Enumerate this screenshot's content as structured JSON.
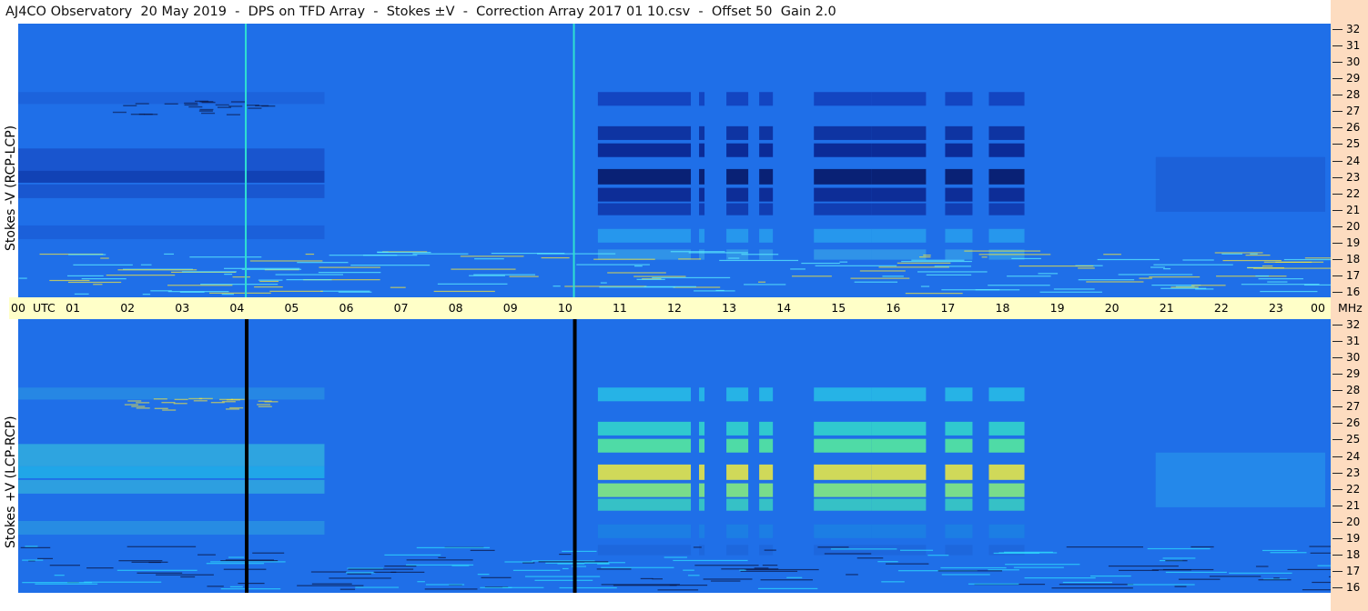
{
  "title": "AJ4CO Observatory  20 May 2019  -  DPS on TFD Array  -  Stokes ±V  -  Correction Array 2017 01 10.csv  -  Offset 50  Gain 2.0",
  "chart_data": [
    {
      "type": "heatmap",
      "ylabel": "Stokes -V (RCP-LCP)",
      "x_units": "UTC",
      "y_units": "MHz",
      "xlim": [
        0,
        24
      ],
      "ylim": [
        16,
        32
      ],
      "colors": {
        "low": "#0a1a6e",
        "mid": "#1f6fe8",
        "high": "#f5e63c"
      },
      "vertical_lines": [
        {
          "hour": 4.17,
          "color": "#2fe0d0"
        },
        {
          "hour": 10.17,
          "color": "#2fe0d0"
        }
      ]
    },
    {
      "type": "heatmap",
      "ylabel": "Stokes +V (LCP-RCP)",
      "x_units": "UTC",
      "y_units": "MHz",
      "xlim": [
        0,
        24
      ],
      "ylim": [
        16,
        32
      ],
      "colors": {
        "low": "#0a1a6e",
        "mid": "#1f6fe8",
        "high": "#f5e63c"
      },
      "vertical_lines": [
        {
          "hour": 4.17,
          "color": "#000000"
        },
        {
          "hour": 10.17,
          "color": "#000000"
        }
      ]
    }
  ],
  "time_axis": {
    "unit_left": "UTC",
    "unit_right": "MHz",
    "ticks": [
      "00",
      "01",
      "02",
      "03",
      "04",
      "05",
      "06",
      "07",
      "08",
      "09",
      "10",
      "11",
      "12",
      "13",
      "14",
      "15",
      "16",
      "17",
      "18",
      "19",
      "20",
      "21",
      "22",
      "23",
      "00"
    ]
  },
  "freq_ticks": [
    "32",
    "31",
    "30",
    "29",
    "28",
    "27",
    "26",
    "25",
    "24",
    "23",
    "22",
    "21",
    "20",
    "19",
    "18",
    "17",
    "16"
  ]
}
